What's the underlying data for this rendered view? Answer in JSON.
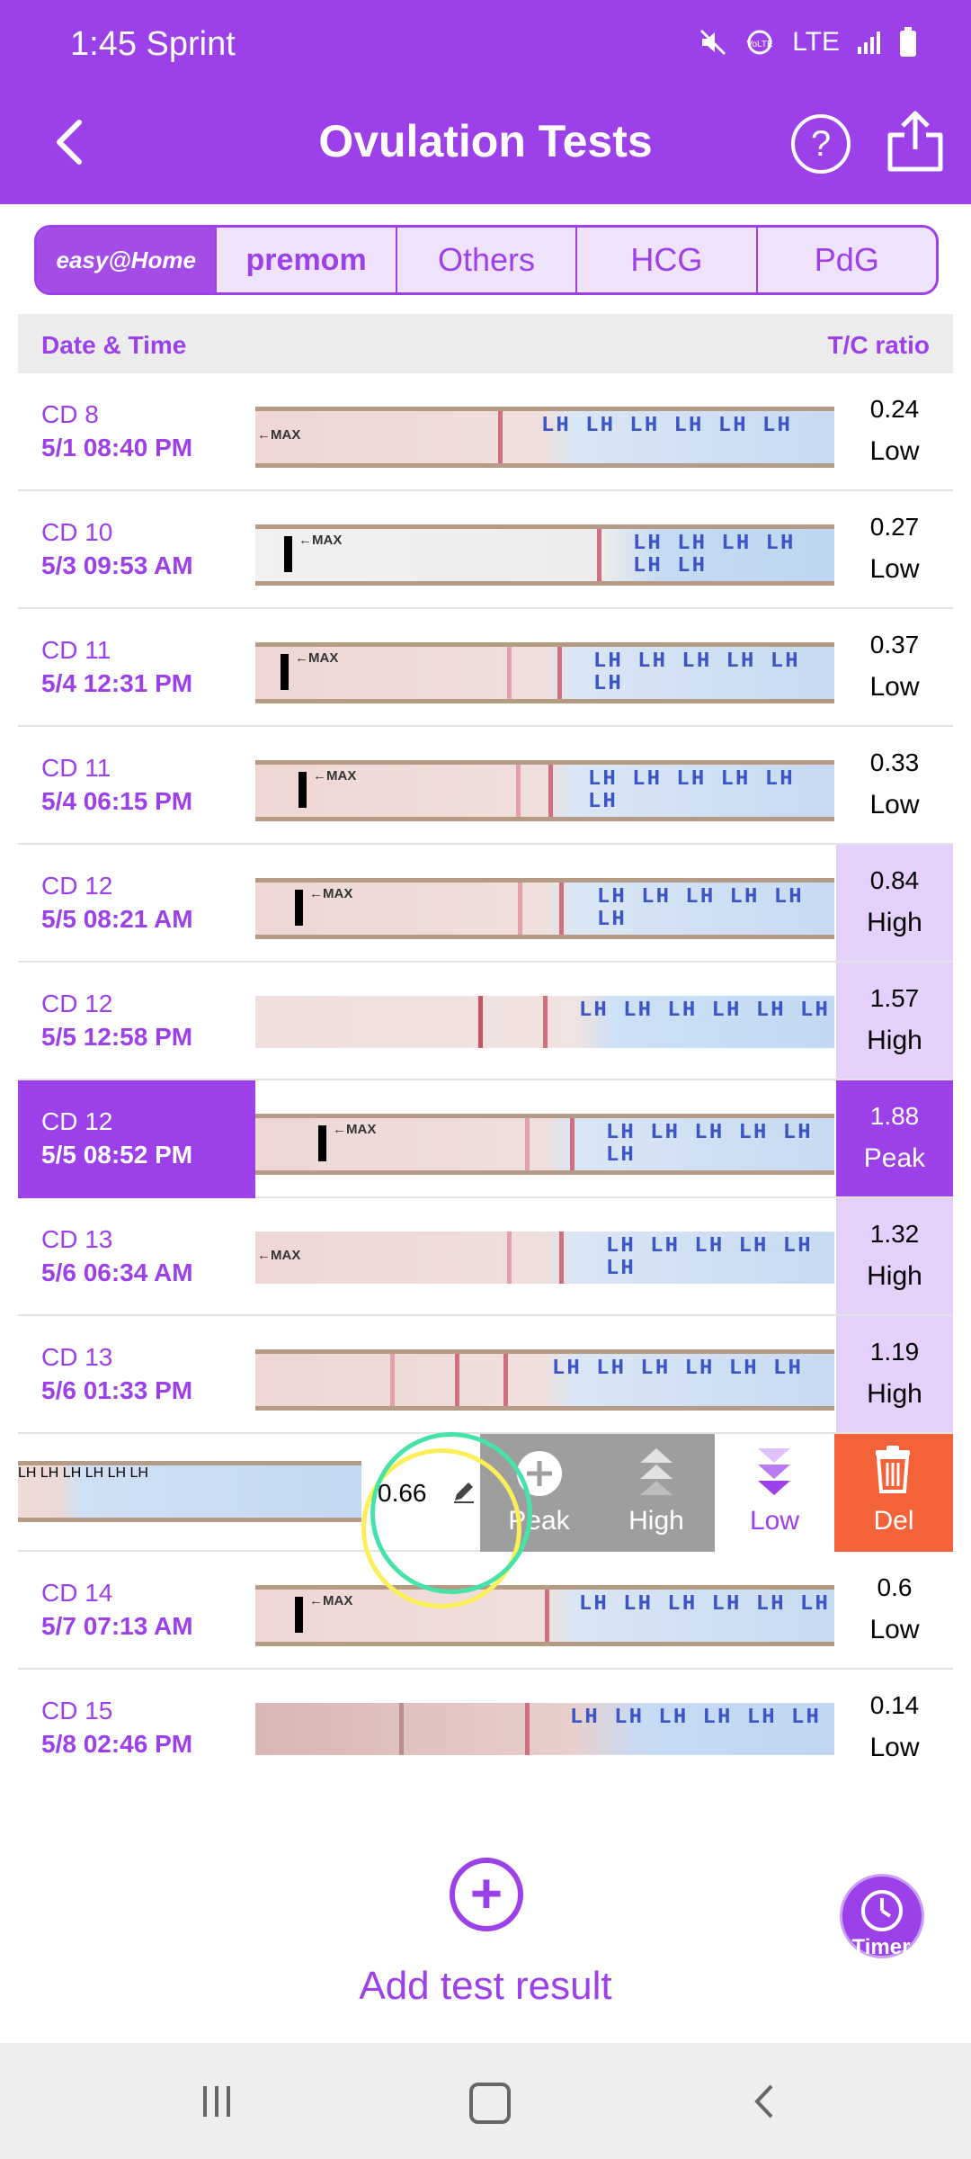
{
  "status_bar": {
    "time": "1:45 Sprint",
    "network": "LTE"
  },
  "app_bar": {
    "title": "Ovulation Tests"
  },
  "brand_tabs": [
    {
      "label": "easy@Home",
      "active": true
    },
    {
      "label": "premom",
      "active": false
    },
    {
      "label": "Others",
      "active": false
    },
    {
      "label": "HCG",
      "active": false
    },
    {
      "label": "PdG",
      "active": false
    }
  ],
  "table_header": {
    "left": "Date & Time",
    "right": "T/C ratio"
  },
  "rows": [
    {
      "cd": "CD 8",
      "datetime": "5/1  08:40 PM",
      "value": "0.24",
      "category": "Low"
    },
    {
      "cd": "CD 10",
      "datetime": "5/3  09:53 AM",
      "value": "0.27",
      "category": "Low"
    },
    {
      "cd": "CD 11",
      "datetime": "5/4  12:31 PM",
      "value": "0.37",
      "category": "Low"
    },
    {
      "cd": "CD 11",
      "datetime": "5/4  06:15 PM",
      "value": "0.33",
      "category": "Low"
    },
    {
      "cd": "CD 12",
      "datetime": "5/5  08:21 AM",
      "value": "0.84",
      "category": "High"
    },
    {
      "cd": "CD 12",
      "datetime": "5/5  12:58 PM",
      "value": "1.57",
      "category": "High"
    },
    {
      "cd": "CD 12",
      "datetime": "5/5  08:52 PM",
      "value": "1.88",
      "category": "Peak"
    },
    {
      "cd": "CD 13",
      "datetime": "5/6  06:34 AM",
      "value": "1.32",
      "category": "High"
    },
    {
      "cd": "CD 13",
      "datetime": "5/6  01:33 PM",
      "value": "1.19",
      "category": "High"
    }
  ],
  "swipe_row": {
    "value": "0.66",
    "actions": {
      "peak": "Peak",
      "high": "High",
      "low": "Low",
      "del": "Del"
    }
  },
  "rows_after": [
    {
      "cd": "CD 14",
      "datetime": "5/7  07:13 AM",
      "value": "0.6",
      "category": "Low"
    },
    {
      "cd": "CD 15",
      "datetime": "5/8  02:46 PM",
      "value": "0.14",
      "category": "Low"
    }
  ],
  "strip_text": {
    "max": "←MAX",
    "lh": "LH LH LH LH LH LH"
  },
  "add_result": {
    "label": "Add test result"
  },
  "timer": {
    "label": "Timer"
  },
  "colors": {
    "accent": "#9c40ea",
    "high_bg": "#e5cffb",
    "delete": "#f4623a"
  }
}
